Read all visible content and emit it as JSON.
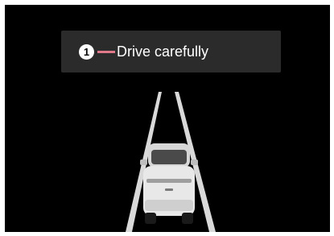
{
  "banner": {
    "callout_number": "1",
    "message": "Drive carefully"
  },
  "icons": {
    "callout": "callout-number-1-icon",
    "vehicle": "car-rear-icon",
    "lanes": "lane-lines-icon"
  },
  "colors": {
    "background": "#000000",
    "banner": "#2b2b2b",
    "callout_line": "#e07a8a",
    "lane_lines": "#d9d9d9",
    "text": "#ffffff"
  }
}
